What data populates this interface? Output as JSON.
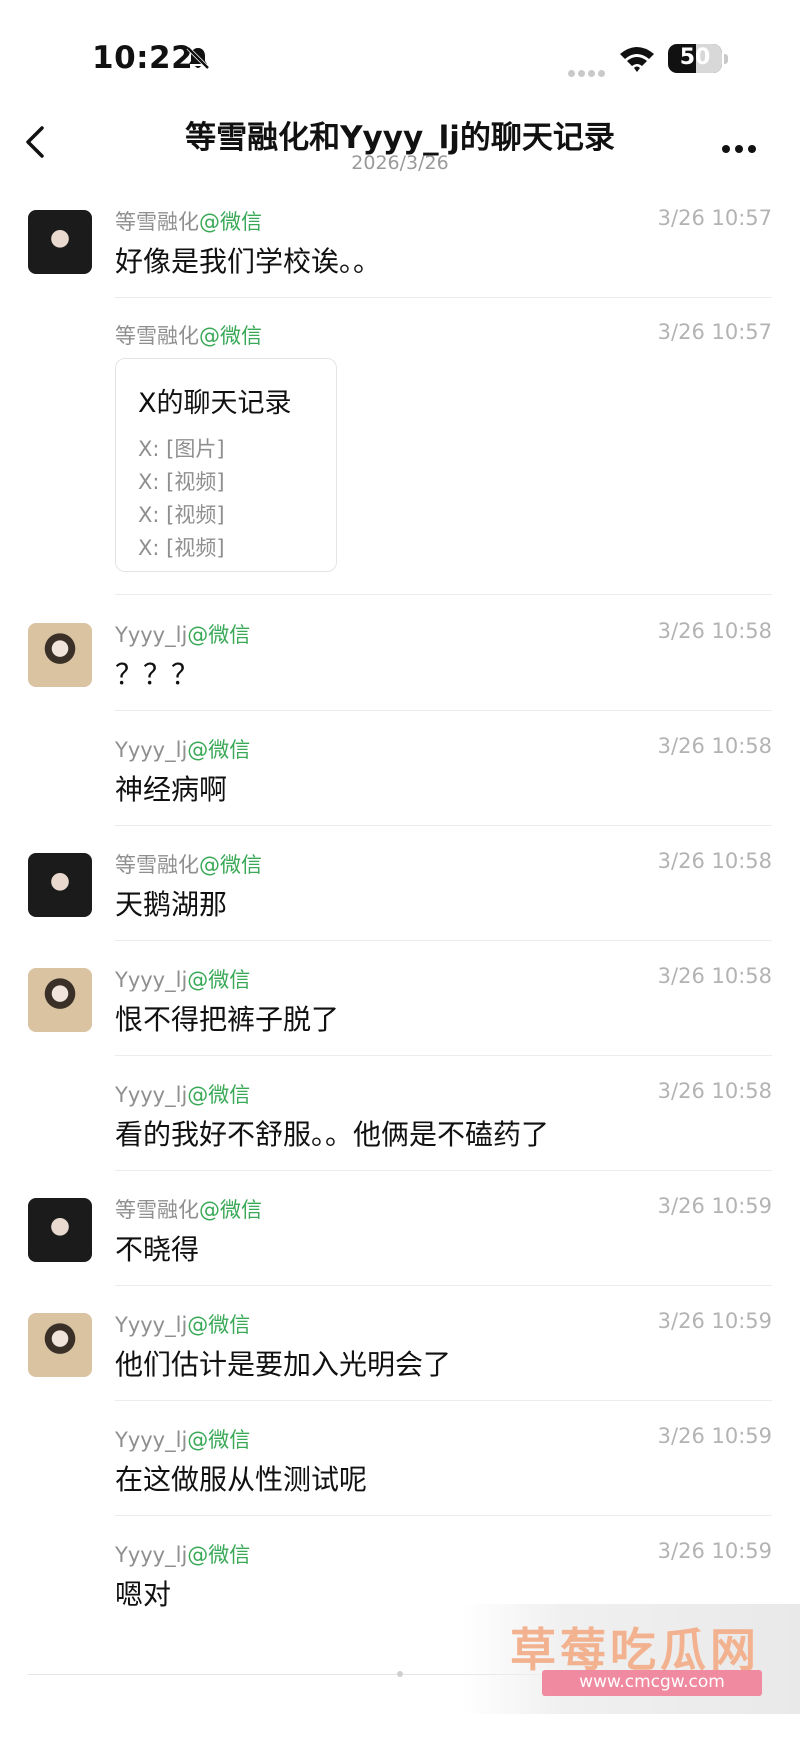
{
  "status_bar": {
    "time": "10:22",
    "battery": "50",
    "battery_level": 0.5
  },
  "header": {
    "title": "等雪融化和Yyyy_lj的聊天记录",
    "date": "2026/3/26"
  },
  "messages": [
    {
      "name": "等雪融化",
      "at": "@微信",
      "time": "3/26 10:57",
      "text": "好像是我们学校诶。。",
      "avatar": "avatar-dark-hair"
    },
    {
      "name": "等雪融化",
      "at": "@微信",
      "time": "3/26 10:57",
      "card": {
        "title": "X的聊天记录",
        "lines": [
          "X: [图片]",
          "X: [视频]",
          "X: [视频]",
          "X: [视频]"
        ]
      }
    },
    {
      "name": "Yyyy_lj",
      "at": "@微信",
      "time": "3/26 10:58",
      "text": "？？？",
      "avatar": "avatar-light"
    },
    {
      "name": "Yyyy_lj",
      "at": "@微信",
      "time": "3/26 10:58",
      "text": "神经病啊"
    },
    {
      "name": "等雪融化",
      "at": "@微信",
      "time": "3/26 10:58",
      "text": "天鹅湖那",
      "avatar": "avatar-dark-hair"
    },
    {
      "name": "Yyyy_lj",
      "at": "@微信",
      "time": "3/26 10:58",
      "text": "恨不得把裤子脱了",
      "avatar": "avatar-light"
    },
    {
      "name": "Yyyy_lj",
      "at": "@微信",
      "time": "3/26 10:58",
      "text": "看的我好不舒服。。他俩是不磕药了"
    },
    {
      "name": "等雪融化",
      "at": "@微信",
      "time": "3/26 10:59",
      "text": "不晓得",
      "avatar": "avatar-dark-hair"
    },
    {
      "name": "Yyyy_lj",
      "at": "@微信",
      "time": "3/26 10:59",
      "text": "他们估计是要加入光明会了",
      "avatar": "avatar-light"
    },
    {
      "name": "Yyyy_lj",
      "at": "@微信",
      "time": "3/26 10:59",
      "text": "在这做服从性测试呢"
    },
    {
      "name": "Yyyy_lj",
      "at": "@微信",
      "time": "3/26 10:59",
      "text": "嗯对"
    }
  ],
  "watermark": {
    "name": "草莓吃瓜网",
    "url": "www.cmcgw.com"
  }
}
